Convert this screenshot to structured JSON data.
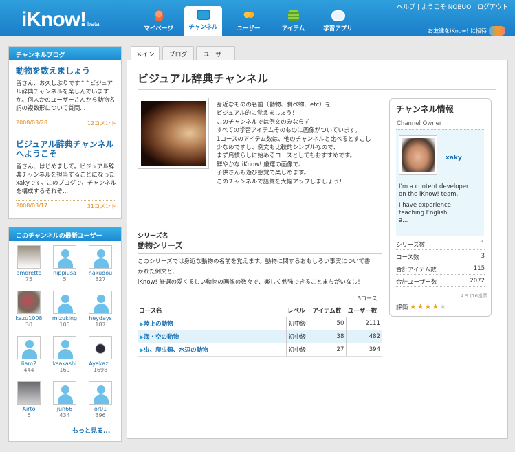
{
  "header": {
    "logo": "iKnow!",
    "beta": "beta",
    "links": "ヘルプ | ようこそ NOBUO | ログアウト",
    "invite": "お友達をiKnow! に招待",
    "nav": [
      "マイページ",
      "チャンネル",
      "ユーザー",
      "アイテム",
      "学習アプリ"
    ]
  },
  "blog": {
    "title": "チャンネルブログ",
    "posts": [
      {
        "title": "動物を数えましょう",
        "body": "皆さん、お久しぶりです^^ビジュアル辞典チャンネルを楽しんでいますか。何人かのユーザーさんから動物名詞の複数形について質問...",
        "date": "2008/03/28",
        "comments": "12コメント"
      },
      {
        "title": "ビジュアル辞典チャンネルへようこそ",
        "body": "皆さん、はじめまして。ビジュアル辞典チャンネルを担当することになったxakyです。このブログで、チャンネルを構成するそれぞ...",
        "date": "2008/03/17",
        "comments": "31コメント"
      }
    ]
  },
  "recent_users": {
    "title": "このチャンネルの最新ユーザー",
    "users": [
      {
        "name": "amoretto",
        "count": "75"
      },
      {
        "name": "nippiusa",
        "count": "5"
      },
      {
        "name": "hakudou",
        "count": "327"
      },
      {
        "name": "kazu1008",
        "count": "30"
      },
      {
        "name": "mizuking",
        "count": "105"
      },
      {
        "name": "heydays",
        "count": "187"
      },
      {
        "name": "liam2",
        "count": "444"
      },
      {
        "name": "ksakashi",
        "count": "169"
      },
      {
        "name": "Ayakazu",
        "count": "1698"
      },
      {
        "name": "Airto",
        "count": "5"
      },
      {
        "name": "jun66",
        "count": "434"
      },
      {
        "name": "or01",
        "count": "396"
      }
    ],
    "more": "もっと見る..."
  },
  "tabs": [
    "メイン",
    "ブログ",
    "ユーザー"
  ],
  "channel": {
    "title": "ビジュアル辞典チャンネル",
    "description": [
      "身近なものの名前（動物、食べ物、etc）を",
      "ビジュアル的に覚えましょう！",
      "このチャンネルでは例文のみならず",
      "すべての学習アイテムそのものに画像がついています。",
      "1コースのアイテム数は、他のチャンネルと比べるとすこし",
      "少なめですし、例文も比較的シンプルなので、",
      "まず肩慣らしに始めるコースとしてもおすすめです。",
      "鮮やかな iKnow! 厳選の画像で、",
      "子供さんも遊び感覚で楽しめます。",
      "このチャンネルで語彙を大幅アップしましょう！"
    ]
  },
  "info": {
    "title": "チャンネル情報",
    "owner_label": "Channel Owner",
    "owner_name": "xaky",
    "owner_bio": [
      "I'm a content developer",
      "on the iKnow! team.",
      "",
      "I have experience",
      "teaching English",
      "a..."
    ],
    "stats": [
      {
        "label": "シリーズ数",
        "value": "1"
      },
      {
        "label": "コース数",
        "value": "3"
      },
      {
        "label": "合計アイテム数",
        "value": "115"
      },
      {
        "label": "合計ユーザー数",
        "value": "2072"
      }
    ],
    "rating_label": "評価",
    "rating_value": 4,
    "rating_max": 5,
    "rating_count": "4.9 (16投票"
  },
  "series": {
    "label": "シリーズ名",
    "name": "動物シリーズ",
    "description": [
      "このシリーズでは身近な動物の名前を覚えます。動物に関するおもしろい事実について書",
      "かれた例文と、",
      "iKnow! 厳選の愛くるしい動物の画像の数々で、楽しく勉強できることまちがいなし！"
    ],
    "course_count": "3コース",
    "columns": [
      "コース名",
      "レベル",
      "アイテム数",
      "ユーザー数"
    ],
    "courses": [
      {
        "name": "陸上の動物",
        "level": "初中級",
        "items": "50",
        "users": "2111"
      },
      {
        "name": "海・空の動物",
        "level": "初中級",
        "items": "38",
        "users": "482"
      },
      {
        "name": "虫、爬虫類、水辺の動物",
        "level": "初中級",
        "items": "27",
        "users": "394"
      }
    ]
  },
  "colors": {
    "brand": "#1a7dc8",
    "link": "#1a6fb0",
    "accent": "#e08a1a",
    "star": "#f0a020"
  }
}
